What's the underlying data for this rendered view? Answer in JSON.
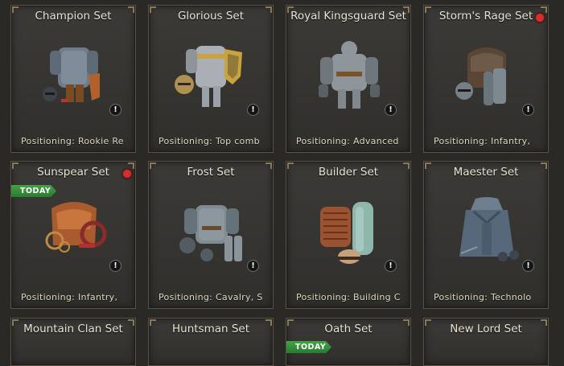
{
  "today_label": "TODAY",
  "sets": [
    {
      "name": "Champion Set",
      "positioning": "Positioning: Rookie Re",
      "info": "!",
      "icon": "champion-armor-icon"
    },
    {
      "name": "Glorious Set",
      "positioning": "Positioning: Top comb",
      "info": "!",
      "icon": "glorious-armor-icon"
    },
    {
      "name": "Royal Kingsguard Set",
      "positioning": "Positioning: Advanced",
      "info": "!",
      "icon": "kingsguard-armor-icon"
    },
    {
      "name": "Storm's Rage Set",
      "positioning": "Positioning: Infantry,",
      "info": "!",
      "icon": "storms-rage-armor-icon",
      "new_dot": true
    },
    {
      "name": "Sunspear Set",
      "positioning": "Positioning: Infantry,",
      "info": "!",
      "icon": "sunspear-armor-icon",
      "new_dot": true,
      "today": true
    },
    {
      "name": "Frost Set",
      "positioning": "Positioning: Cavalry, S",
      "info": "!",
      "icon": "frost-armor-icon"
    },
    {
      "name": "Builder Set",
      "positioning": "Positioning: Building C",
      "info": "!",
      "icon": "builder-armor-icon"
    },
    {
      "name": "Maester Set",
      "positioning": "Positioning: Technolo",
      "info": "!",
      "icon": "maester-robe-icon"
    },
    {
      "name": "Mountain Clan Set"
    },
    {
      "name": "Huntsman Set"
    },
    {
      "name": "Oath Set",
      "today": true
    },
    {
      "name": "New Lord Set"
    }
  ]
}
